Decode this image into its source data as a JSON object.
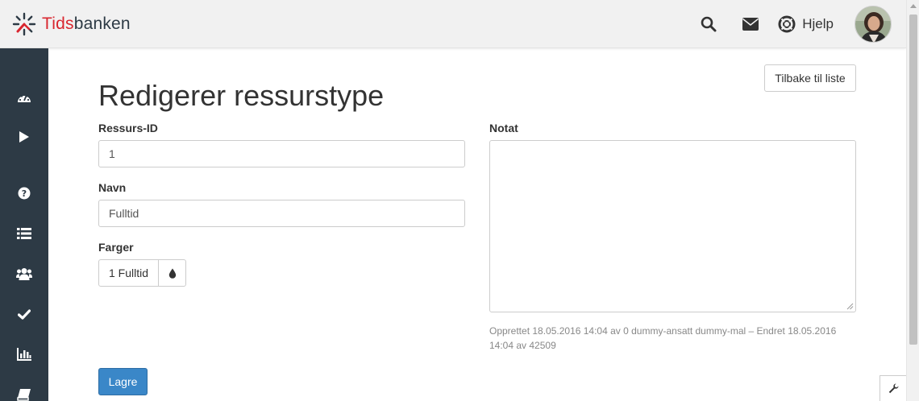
{
  "brand": {
    "name_part1": "Tids",
    "name_part2": "banken",
    "accent": "#d9262f",
    "dark": "#2d3a45"
  },
  "topbar": {
    "icons": [
      "search-icon",
      "envelope-icon",
      "life-ring-icon"
    ],
    "help_label": "Hjelp"
  },
  "sidebar": {
    "background": "#2d3a45",
    "items": [
      "dashboard-icon",
      "play-icon",
      "question-icon",
      "list-icon",
      "users-icon",
      "check-icon",
      "bar-chart-icon",
      "book-icon"
    ]
  },
  "page": {
    "title": "Redigerer ressurstype",
    "back_button": "Tilbake til liste"
  },
  "form": {
    "resource_id_label": "Ressurs-ID",
    "resource_id_value": "1",
    "name_label": "Navn",
    "name_value": "Fulltid",
    "colors_label": "Farger",
    "colors_value": "1 Fulltid",
    "note_label": "Notat",
    "note_value": "",
    "meta_text": "Opprettet 18.05.2016 14:04 av 0 dummy-ansatt dummy-mal – Endret 18.05.2016 14:04 av 42509",
    "save_button": "Lagre",
    "save_color": "#3a87c8"
  },
  "corner_tool": "wrench-icon"
}
